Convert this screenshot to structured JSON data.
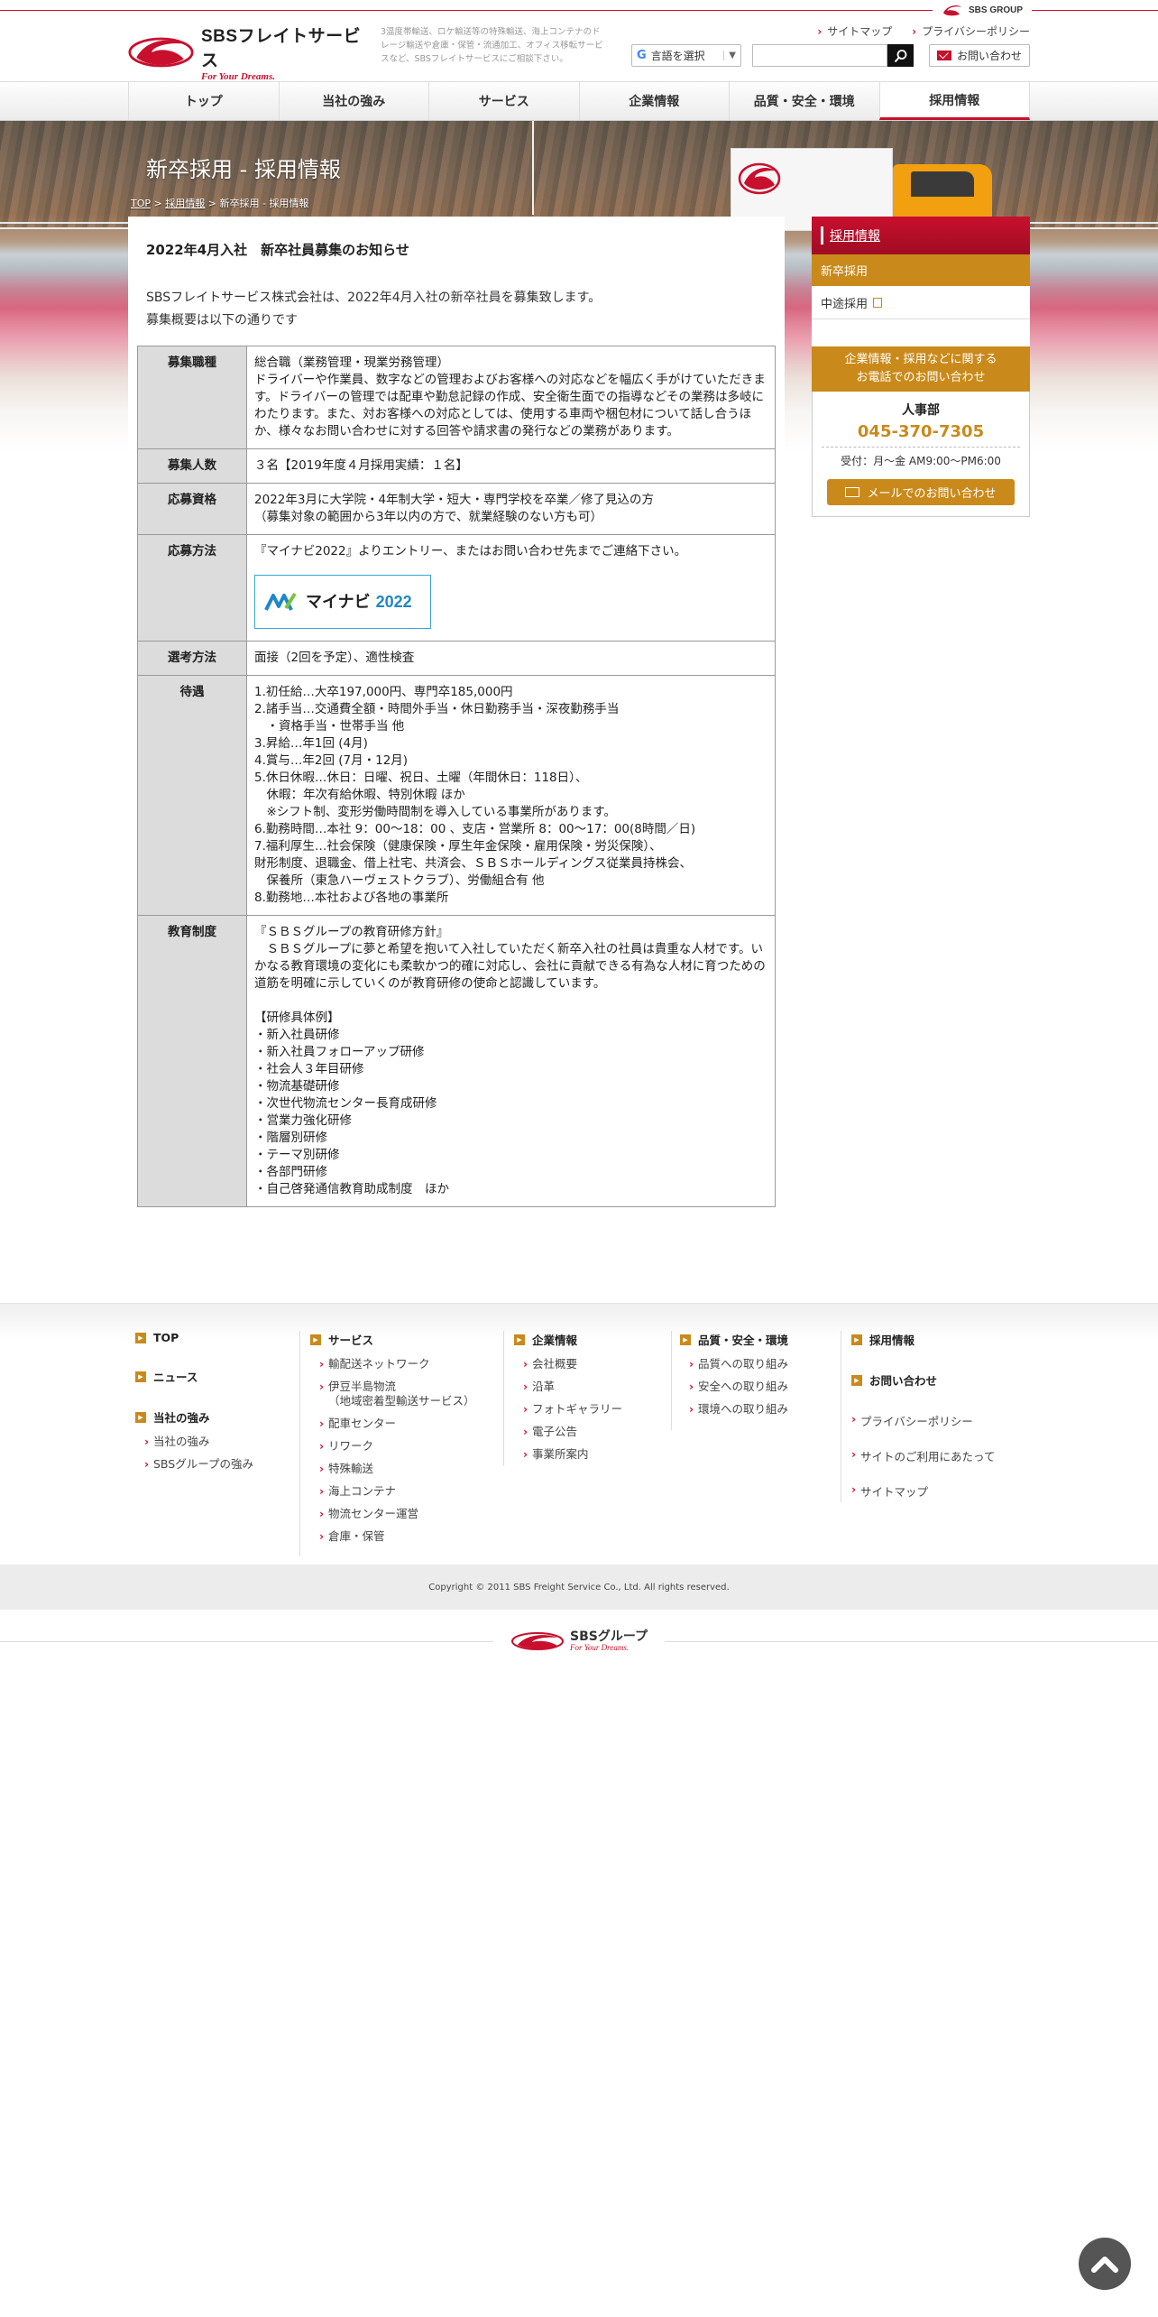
{
  "group": {
    "label": "SBS GROUP"
  },
  "header": {
    "logo_name": "SBSフレイトサービス",
    "logo_tagline": "For Your Dreams.",
    "description": "3温度帯輸送、ロケ輸送等の特殊輸送、海上コンテナのドレージ輸送や倉庫・保管・流通加工、オフィス移転サービスなど、SBSフレイトサービスにご相談下さい。",
    "util_links": [
      "サイトマップ",
      "プライバシーポリシー"
    ],
    "lang_label": "言語を選択",
    "search_placeholder": "",
    "contact_label": "お問い合わせ"
  },
  "nav": {
    "items": [
      "トップ",
      "当社の強み",
      "サービス",
      "企業情報",
      "品質・安全・環境",
      "採用情報"
    ]
  },
  "hero": {
    "title": "新卒採用 - 採用情報",
    "breadcrumb": {
      "top": "TOP",
      "sep1": " > ",
      "parent": "採用情報",
      "sep2": " > ",
      "current": "新卒採用 - 採用情報"
    }
  },
  "main": {
    "heading": "2022年4月入社　新卒社員募集のお知らせ",
    "intro": [
      "SBSフレイトサービス株式会社は、2022年4月入社の新卒社員を募集致します。",
      "募集概要は以下の通りです"
    ],
    "rows": {
      "job": {
        "label": "募集職種",
        "lines": [
          "総合職（業務管理・現業労務管理）",
          "ドライバーや作業員、数字などの管理およびお客様への対応などを幅広く手がけていただきます。ドライバーの管理では配車や勤怠記録の作成、安全衛生面での指導などその業務は多岐にわたります。また、対お客様への対応としては、使用する車両や梱包材について話し合うほか、様々なお問い合わせに対する回答や請求書の発行などの業務があります。"
        ]
      },
      "count": {
        "label": "募集人数",
        "lines": [
          "３名【2019年度４月採用実績：１名】"
        ]
      },
      "qual": {
        "label": "応募資格",
        "lines": [
          "2022年3月に大学院・4年制大学・短大・専門学校を卒業／修了見込の方",
          "（募集対象の範囲から3年以内の方で、就業経験のない方も可）"
        ]
      },
      "apply": {
        "label": "応募方法",
        "lines": [
          "『マイナビ2022』よりエントリー、またはお問い合わせ先までご連絡下さい。"
        ],
        "banner_text": "マイナビ",
        "banner_year": "2022"
      },
      "select": {
        "label": "選考方法",
        "lines": [
          "面接（2回を予定）、適性検査"
        ]
      },
      "benefit": {
        "label": "待遇",
        "lines": [
          "1.初任給…大卒197,000円、専門卒185,000円",
          "2.諸手当…交通費全額・時間外手当・休日勤務手当・深夜勤務手当",
          "　・資格手当・世帯手当 他",
          "3.昇給…年1回 (4月)",
          "4.賞与…年2回 (7月・12月)",
          "5.休日休暇…休日：日曜、祝日、土曜（年間休日：118日）、",
          "　休暇：年次有給休暇、特別休暇 ほか",
          "　※シフト制、変形労働時間制を導入している事業所があります。",
          "6.勤務時間…本社 9：00～18：00 、支店・営業所 8：00～17：00(8時間／日)",
          "7.福利厚生…社会保険（健康保険・厚生年金保険・雇用保険・労災保険）、",
          "財形制度、退職金、借上社宅、共済会、ＳＢＳホールディングス従業員持株会、",
          "　保養所（東急ハーヴェストクラブ）、労働組合有 他",
          "8.勤務地…本社および各地の事業所"
        ]
      },
      "edu": {
        "label": "教育制度",
        "lines": [
          "『ＳＢＳグループの教育研修方針』",
          "　ＳＢＳグループに夢と希望を抱いて入社していただく新卒入社の社員は貴重な人材です。いかなる教育環境の変化にも柔軟かつ的確に対応し、会社に貢献できる有為な人材に育つための道筋を明確に示していくのが教育研修の使命と認識しています。",
          "",
          "【研修具体例】",
          "・新入社員研修",
          "・新入社員フォローアップ研修",
          "・社会人３年目研修",
          "・物流基礎研修",
          "・次世代物流センター長育成研修",
          "・営業力強化研修",
          "・階層別研修",
          "・テーマ別研修",
          "・各部門研修",
          "・自己啓発通信教育助成制度　ほか"
        ]
      }
    }
  },
  "side": {
    "head": "採用情報",
    "items": [
      "新卒採用",
      "中途採用"
    ],
    "contact_title": [
      "企業情報・採用などに関する",
      "お電話でのお問い合わせ"
    ],
    "dept": "人事部",
    "tel": "045-370-7305",
    "hours": "受付：月～金 AM9:00～PM6:00",
    "mail_label": "メールでのお問い合わせ"
  },
  "footer": {
    "col1": {
      "sections": [
        "TOP",
        "ニュース",
        "当社の強み"
      ],
      "strength_subs": [
        "当社の強み",
        "SBSグループの強み"
      ]
    },
    "col2": {
      "section": "サービス",
      "subs": [
        "輸配送ネットワーク",
        "伊豆半島物流",
        "（地域密着型輸送サービス）",
        "配車センター",
        "リワーク",
        "特殊輸送",
        "海上コンテナ",
        "物流センター運営",
        "倉庫・保管"
      ]
    },
    "col3": {
      "section": "企業情報",
      "subs": [
        "会社概要",
        "沿革",
        "フォトギャラリー",
        "電子公告",
        "事業所案内"
      ]
    },
    "col4": {
      "section": "品質・安全・環境",
      "subs": [
        "品質への取り組み",
        "安全への取り組み",
        "環境への取り組み"
      ]
    },
    "col5": {
      "sections": [
        "採用情報",
        "お問い合わせ"
      ],
      "plain": [
        "プライバシーポリシー",
        "サイトのご利用にあたって",
        "サイトマップ"
      ]
    },
    "copyright": "Copyright © 2011 SBS Freight Service Co., Ltd. All rights reserved.",
    "brand_name": "SBSグループ",
    "brand_tagline": "For Your Dreams."
  },
  "colors": {
    "brand_red": "#c8102e",
    "accent_gold": "#c98a1b"
  },
  "icons": [
    "search-icon",
    "mail-icon",
    "google-icon",
    "external-link-icon",
    "chevron-up-icon"
  ]
}
